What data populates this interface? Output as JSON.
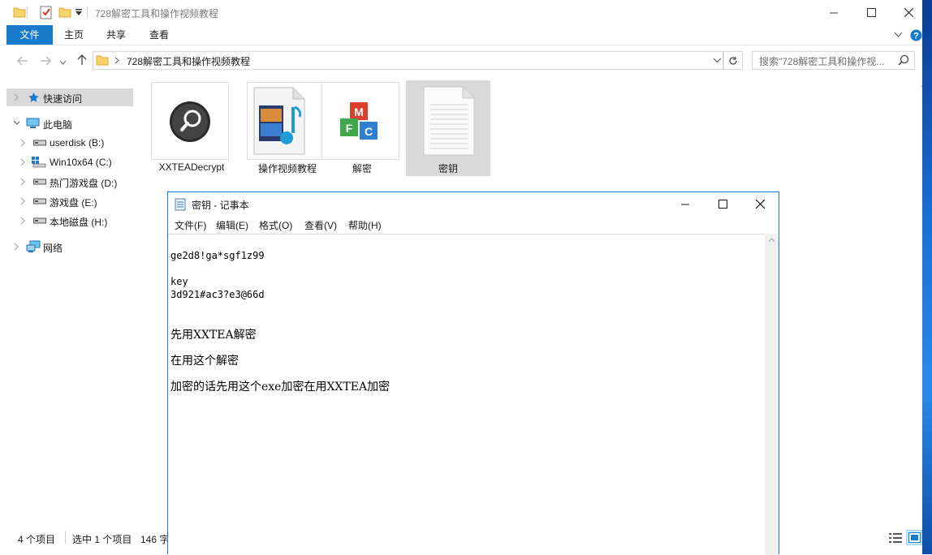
{
  "explorer": {
    "title": "728解密工具和操作视频教程",
    "ribbon_tabs": [
      "文件",
      "主页",
      "共享",
      "查看"
    ],
    "address_path": "728解密工具和操作视频教程",
    "search_placeholder": "搜索\"728解密工具和操作视...",
    "sidebar": {
      "quick_access": "快速访问",
      "this_pc": "此电脑",
      "drives": [
        "userdisk (B:)",
        "Win10x64 (C:)",
        "热门游戏盘 (D:)",
        "游戏盘 (E:)",
        "本地磁盘 (H:)"
      ],
      "network": "网络"
    },
    "files": [
      {
        "name": "XXTEADecrypt",
        "icon": "magnifier-app-icon"
      },
      {
        "name": "操作视频教程",
        "icon": "video-file-icon"
      },
      {
        "name": "解密",
        "icon": "mfc-app-icon"
      },
      {
        "name": "密钥",
        "icon": "text-file-icon"
      }
    ],
    "status": {
      "item_count": "4 个项目",
      "selected": "选中 1 个项目",
      "size": "146 字"
    }
  },
  "notepad": {
    "title": "密钥 - 记事本",
    "menu": [
      "文件(F)",
      "编辑(E)",
      "格式(O)",
      "查看(V)",
      "帮助(H)"
    ],
    "lines": [
      "ge2d8!ga*sgf1z99",
      "key",
      "3d921#ac3?e3@66d",
      "先用XXTEA解密",
      "在用这个解密",
      "加密的话先用这个exe加密在用XXTEA加密"
    ]
  },
  "colors": {
    "accent": "#1979ca",
    "selection": "#d9d9d9",
    "folder": "#f8d26a"
  }
}
